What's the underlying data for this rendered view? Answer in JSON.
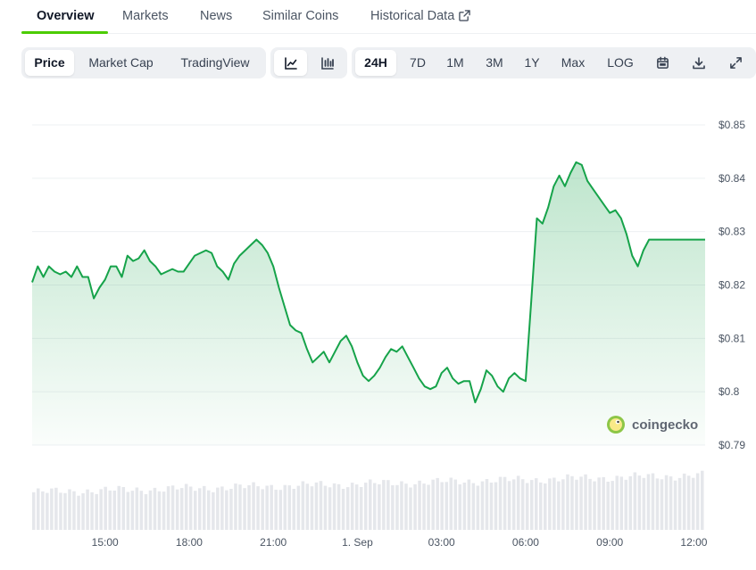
{
  "tabs": [
    {
      "label": "Overview",
      "active": true
    },
    {
      "label": "Markets"
    },
    {
      "label": "News"
    },
    {
      "label": "Similar Coins"
    },
    {
      "label": "Historical Data",
      "external_icon": "external-link-icon"
    }
  ],
  "toolbar": {
    "views": [
      "Price",
      "Market Cap",
      "TradingView"
    ],
    "active_view": "Price",
    "chart_types": [
      {
        "icon": "line-chart-icon",
        "active": true
      },
      {
        "icon": "candlestick-icon"
      }
    ],
    "ranges": [
      "24H",
      "7D",
      "1M",
      "3M",
      "1Y",
      "Max",
      "LOG"
    ],
    "active_range": "24H",
    "actions": [
      "calendar-icon",
      "download-icon",
      "expand-icon"
    ]
  },
  "watermark": "coingecko",
  "colors": {
    "line": "#16a34a",
    "accent": "#4bcc00",
    "volume": "#e5e7eb"
  },
  "chart_data": {
    "type": "area",
    "x_tick_labels": [
      "15:00",
      "18:00",
      "21:00",
      "1. Sep",
      "03:00",
      "06:00",
      "09:00",
      "12:00"
    ],
    "x_ticks_hours": [
      15,
      18,
      21,
      24,
      27,
      30,
      33,
      36
    ],
    "y_tick_labels": [
      "$0.85",
      "$0.84",
      "$0.83",
      "$0.82",
      "$0.81",
      "$0.8",
      "$0.79"
    ],
    "y_ticks": [
      0.85,
      0.84,
      0.83,
      0.82,
      0.81,
      0.8,
      0.79
    ],
    "ylim": [
      0.79,
      0.85
    ],
    "xlim_hours": [
      12.4,
      36.4
    ],
    "grid": true,
    "series": [
      {
        "x_hours": [
          12.4,
          12.6,
          12.8,
          13.0,
          13.2,
          13.4,
          13.6,
          13.8,
          14.0,
          14.2,
          14.4,
          14.6,
          14.8,
          15.0,
          15.2,
          15.4,
          15.6,
          15.8,
          16.0,
          16.2,
          16.4,
          16.6,
          16.8,
          17.0,
          17.2,
          17.4,
          17.6,
          17.8,
          18.0,
          18.2,
          18.4,
          18.6,
          18.8,
          19.0,
          19.2,
          19.4,
          19.6,
          19.8,
          20.0,
          20.2,
          20.4,
          20.6,
          20.8,
          21.0,
          21.2,
          21.4,
          21.6,
          21.8,
          22.0,
          22.2,
          22.4,
          22.6,
          22.8,
          23.0,
          23.2,
          23.4,
          23.6,
          23.8,
          24.0,
          24.2,
          24.4,
          24.6,
          24.8,
          25.0,
          25.2,
          25.4,
          25.6,
          25.8,
          26.0,
          26.2,
          26.4,
          26.6,
          26.8,
          27.0,
          27.2,
          27.4,
          27.6,
          27.8,
          28.0,
          28.2,
          28.4,
          28.6,
          28.8,
          29.0,
          29.2,
          29.4,
          29.6,
          29.8,
          30.0,
          30.2,
          30.4,
          30.6,
          30.8,
          31.0,
          31.2,
          31.4,
          31.6,
          31.8,
          32.0,
          32.2,
          32.4,
          32.6,
          32.8,
          33.0,
          33.2,
          33.4,
          33.6,
          33.8,
          34.0,
          34.2,
          34.4,
          34.6,
          34.8,
          35.0,
          35.2,
          35.4,
          35.6,
          35.8,
          36.0,
          36.2,
          36.4
        ],
        "values": [
          0.8205,
          0.8235,
          0.8215,
          0.8235,
          0.8225,
          0.822,
          0.8225,
          0.8215,
          0.8235,
          0.8215,
          0.8215,
          0.8175,
          0.8195,
          0.821,
          0.8235,
          0.8235,
          0.8215,
          0.8255,
          0.8245,
          0.825,
          0.8265,
          0.8245,
          0.8235,
          0.822,
          0.8225,
          0.823,
          0.8225,
          0.8225,
          0.824,
          0.8255,
          0.826,
          0.8265,
          0.826,
          0.8235,
          0.8225,
          0.821,
          0.824,
          0.8255,
          0.8265,
          0.8275,
          0.8285,
          0.8275,
          0.826,
          0.8235,
          0.8195,
          0.816,
          0.8125,
          0.8115,
          0.811,
          0.808,
          0.8055,
          0.8065,
          0.8075,
          0.8055,
          0.8075,
          0.8095,
          0.8105,
          0.8085,
          0.8055,
          0.803,
          0.802,
          0.803,
          0.8045,
          0.8065,
          0.808,
          0.8075,
          0.8085,
          0.8065,
          0.8045,
          0.8025,
          0.801,
          0.8005,
          0.801,
          0.8035,
          0.8045,
          0.8025,
          0.8015,
          0.802,
          0.802,
          0.798,
          0.8005,
          0.804,
          0.803,
          0.801,
          0.8,
          0.8025,
          0.8035,
          0.8025,
          0.802,
          0.817,
          0.8325,
          0.8315,
          0.8345,
          0.8385,
          0.8405,
          0.8385,
          0.841,
          0.843,
          0.8425,
          0.8395,
          0.838,
          0.8365,
          0.835,
          0.8335,
          0.834,
          0.8325,
          0.8295,
          0.8255,
          0.8235,
          0.8265,
          0.8285,
          0.8285,
          0.8285,
          0.8285,
          0.8285,
          0.8285,
          0.8285,
          0.8285,
          0.8285,
          0.8285,
          0.8285
        ]
      }
    ],
    "volume_shown": true
  }
}
